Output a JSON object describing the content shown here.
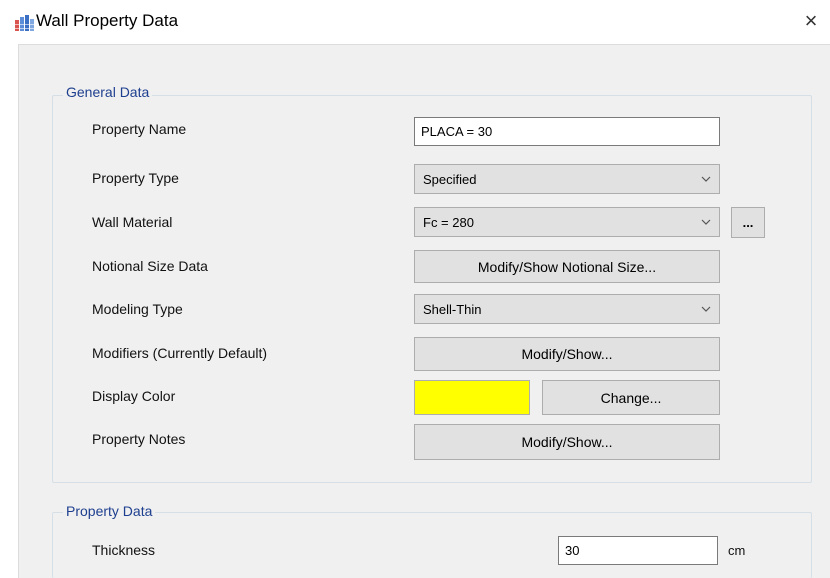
{
  "window": {
    "title": "Wall Property Data",
    "close_glyph": "×",
    "icon": "etabs-app-icon"
  },
  "general_data": {
    "title": "General Data",
    "property_name": {
      "label": "Property Name",
      "value": "PLACA = 30"
    },
    "property_type": {
      "label": "Property Type",
      "value": "Specified",
      "icon": "chevron-down-icon"
    },
    "wall_material": {
      "label": "Wall Material",
      "value": "Fc = 280",
      "icon": "chevron-down-icon",
      "more_button": "..."
    },
    "notional_size": {
      "label": "Notional Size Data",
      "button": "Modify/Show Notional Size..."
    },
    "modeling_type": {
      "label": "Modeling Type",
      "value": "Shell-Thin",
      "icon": "chevron-down-icon"
    },
    "modifiers": {
      "label": "Modifiers (Currently Default)",
      "button": "Modify/Show..."
    },
    "display_color": {
      "label": "Display Color",
      "color": "#ffff00",
      "button": "Change..."
    },
    "property_notes": {
      "label": "Property Notes",
      "button": "Modify/Show..."
    }
  },
  "property_data": {
    "title": "Property Data",
    "thickness": {
      "label": "Thickness",
      "value": "30",
      "unit": "cm"
    }
  }
}
